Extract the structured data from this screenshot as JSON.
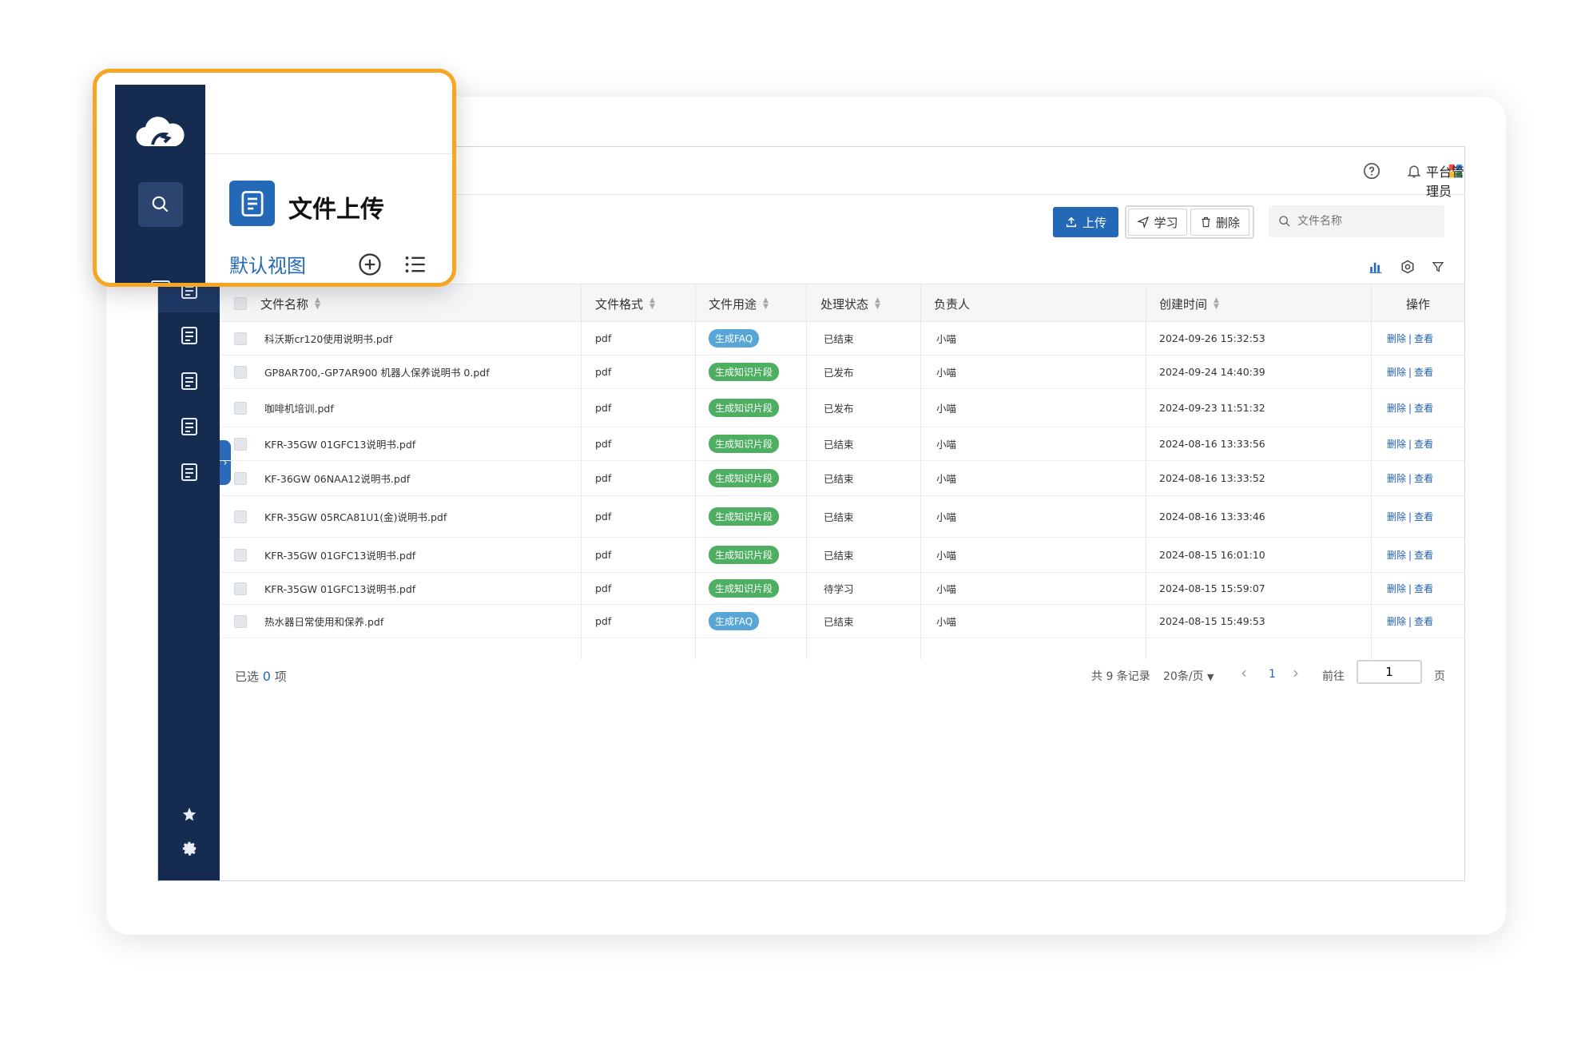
{
  "header": {
    "user_name": "平台管理员",
    "help_icon": "help-circle-icon",
    "bell_icon": "bell-icon",
    "apps_icon": "apps-grid-icon"
  },
  "toolbar": {
    "upload_label": "上传",
    "learn_label": "学习",
    "delete_label": "删除",
    "search_placeholder": "文件名称"
  },
  "table": {
    "columns": [
      "文件名称",
      "文件格式",
      "文件用途",
      "处理状态",
      "负责人",
      "创建时间",
      "操作"
    ],
    "rows": [
      {
        "name": "科沃斯cr120使用说明书.pdf",
        "format": "pdf",
        "usage": "生成FAQ",
        "status": "已结束",
        "owner": "小喵",
        "created": "2024-09-26 15:32:53",
        "op_delete": "删除",
        "op_sep": "|",
        "op_view": "查看"
      },
      {
        "name": "GP8AR700,-GP7AR900 机器人保养说明书 0.pdf",
        "format": "pdf",
        "usage": "生成知识片段",
        "status": "已发布",
        "owner": "小喵",
        "created": "2024-09-24 14:40:39",
        "op_delete": "删除",
        "op_sep": "|",
        "op_view": "查看"
      },
      {
        "name": "咖啡机培训.pdf",
        "format": "pdf",
        "usage": "生成知识片段",
        "status": "已发布",
        "owner": "小喵",
        "created": "2024-09-23 11:51:32",
        "op_delete": "删除",
        "op_sep": "|",
        "op_view": "查看"
      },
      {
        "name": "KFR-35GW 01GFC13说明书.pdf",
        "format": "pdf",
        "usage": "生成知识片段",
        "status": "已结束",
        "owner": "小喵",
        "created": "2024-08-16 13:33:56",
        "op_delete": "删除",
        "op_sep": "|",
        "op_view": "查看"
      },
      {
        "name": "KF-36GW 06NAA12说明书.pdf",
        "format": "pdf",
        "usage": "生成知识片段",
        "status": "已结束",
        "owner": "小喵",
        "created": "2024-08-16 13:33:52",
        "op_delete": "删除",
        "op_sep": "|",
        "op_view": "查看"
      },
      {
        "name": "KFR-35GW 05RCA81U1(金)说明书.pdf",
        "format": "pdf",
        "usage": "生成知识片段",
        "status": "已结束",
        "owner": "小喵",
        "created": "2024-08-16 13:33:46",
        "op_delete": "删除",
        "op_sep": "|",
        "op_view": "查看"
      },
      {
        "name": "KFR-35GW 01GFC13说明书.pdf",
        "format": "pdf",
        "usage": "生成知识片段",
        "status": "已结束",
        "owner": "小喵",
        "created": "2024-08-15 16:01:10",
        "op_delete": "删除",
        "op_sep": "|",
        "op_view": "查看"
      },
      {
        "name": "KFR-35GW 01GFC13说明书.pdf",
        "format": "pdf",
        "usage": "生成知识片段",
        "status": "待学习",
        "owner": "小喵",
        "created": "2024-08-15 15:59:07",
        "op_delete": "删除",
        "op_sep": "|",
        "op_view": "查看"
      },
      {
        "name": "热水器日常使用和保养.pdf",
        "format": "pdf",
        "usage": "生成FAQ",
        "status": "已结束",
        "owner": "小喵",
        "created": "2024-08-15 15:49:53",
        "op_delete": "删除",
        "op_sep": "|",
        "op_view": "查看"
      }
    ]
  },
  "footer": {
    "selected_prefix": "已选",
    "selected_count": "0",
    "selected_suffix": "项",
    "total": "共 9 条记录",
    "page_size": "20条/页",
    "prev": "‹",
    "current_page": "1",
    "next": "›",
    "goto_label": "前往",
    "goto_value": "1",
    "page_unit": "页"
  },
  "popup": {
    "title": "文件上传",
    "view_label": "默认视图"
  },
  "colors": {
    "sidebar": "#152b50",
    "primary": "#2469b8",
    "highlight": "#f5a623",
    "tag_faq": "#58a6d8",
    "tag_knowledge": "#4eaf63"
  }
}
